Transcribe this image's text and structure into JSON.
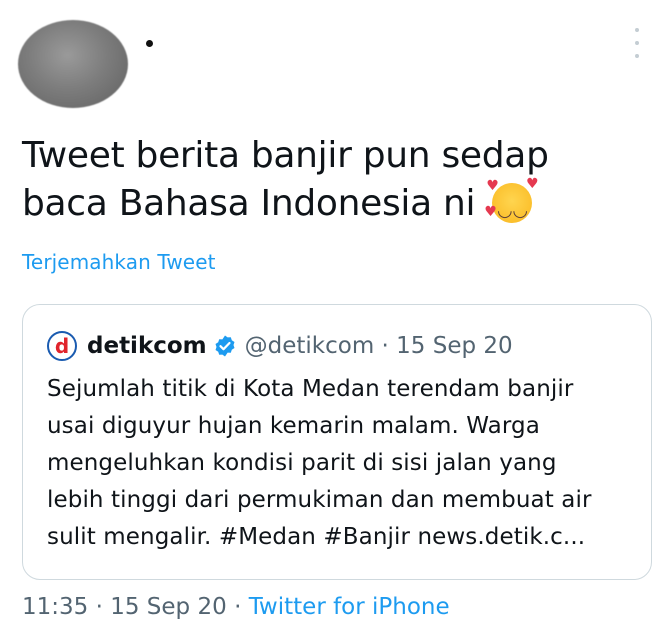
{
  "tweet": {
    "text_line1": "Tweet berita banjir pun sedap",
    "text_line2": "baca Bahasa Indonesia ni",
    "emoji_name": "smiling-face-with-hearts",
    "translate_label": "Terjemahkan Tweet",
    "time": "11:35",
    "date": "15 Sep 20",
    "separator": "·",
    "source": "Twitter for iPhone"
  },
  "quoted": {
    "logo_letter": "d",
    "name": "detikcom",
    "handle_meta": "@detikcom · 15 Sep 20",
    "lines": [
      "Sejumlah titik di Kota Medan terendam banjir",
      "usai diguyur hujan kemarin malam. Warga",
      "mengeluhkan kondisi parit di sisi jalan yang",
      "lebih tinggi dari permukiman dan membuat air",
      "sulit mengalir. #Medan #Banjir news.detik.c..."
    ]
  },
  "colors": {
    "link": "#1d9bf0",
    "muted": "#536471",
    "text": "#0f1419",
    "border": "#cfd9de"
  }
}
